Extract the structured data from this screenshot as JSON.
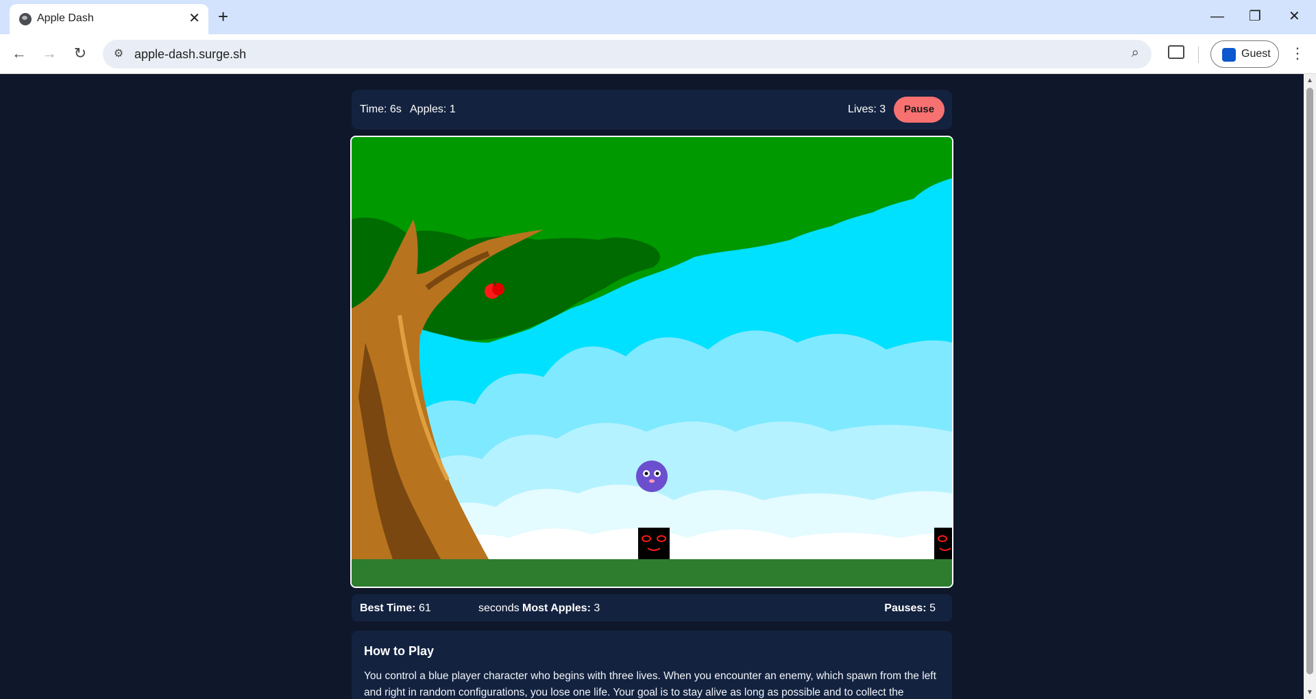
{
  "browser": {
    "tab_title": "Apple Dash",
    "url": "apple-dash.surge.sh",
    "profile_label": "Guest",
    "icons": [
      "globe-icon",
      "close-icon",
      "plus-icon",
      "minimize-icon",
      "restore-icon",
      "back-icon",
      "forward-icon",
      "reload-icon",
      "site-info-icon",
      "zoom-icon",
      "cast-icon",
      "profile-icon",
      "menu-icon"
    ]
  },
  "hud": {
    "time": "Time: 6s",
    "apples": "Apples: 1",
    "lives": "Lives: 3",
    "pause_label": "Pause"
  },
  "stats": {
    "best_time_label": "Best Time:",
    "best_time_value": "61",
    "best_time_unit": "seconds",
    "most_apples_label": "Most Apples:",
    "most_apples_value": "3",
    "pauses_label": "Pauses:",
    "pauses_value": "5"
  },
  "howto": {
    "title": "How to Play",
    "body": "You control a blue player character who begins with three lives. When you encounter an enemy, which spawn from the left and right in random configurations, you lose one life. Your goal is to stay alive as long as possible and to collect the"
  },
  "colors": {
    "page_bg": "#0f172a",
    "panel_bg": "#13223f",
    "pause_button": "#f87171",
    "sky": "#00e0ff",
    "ground": "#2e7d2e",
    "foliage": "#009900",
    "trunk": "#b8731e",
    "player": "#6b4fcf",
    "enemy": "#000000",
    "apple": "#ff1a1a"
  }
}
